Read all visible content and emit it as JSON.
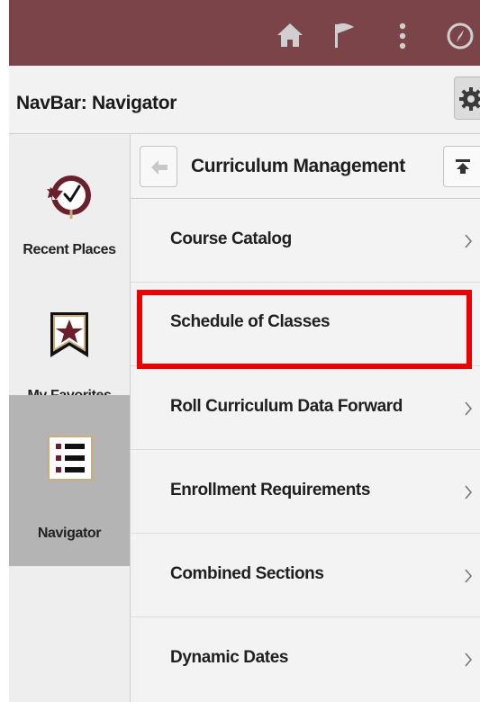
{
  "topbar": {
    "icons": [
      "home-icon",
      "flag-icon",
      "more-vertical-icon",
      "compass-icon"
    ]
  },
  "titlebar": {
    "title": "NavBar: Navigator",
    "settings_icon": "gear-icon"
  },
  "rail": {
    "items": [
      {
        "label": "Recent Places",
        "icon": "history-clock-icon"
      },
      {
        "label": "My Favorites",
        "icon": "star-bookmark-icon"
      },
      {
        "label": "Navigator",
        "icon": "list-icon",
        "active": true
      }
    ]
  },
  "content": {
    "title": "Curriculum Management",
    "back_icon": "back-arrow-icon",
    "top_icon": "scroll-top-icon",
    "items": [
      {
        "label": "Course Catalog"
      },
      {
        "label": "Schedule of Classes",
        "highlighted": true
      },
      {
        "label": "Roll Curriculum Data Forward"
      },
      {
        "label": "Enrollment Requirements"
      },
      {
        "label": "Combined Sections"
      },
      {
        "label": "Dynamic Dates"
      }
    ]
  },
  "colors": {
    "topbar": "#7a4448",
    "brand_maroon": "#6b1f2a",
    "gold": "#c9ae7a",
    "highlight": "#ee0000"
  }
}
